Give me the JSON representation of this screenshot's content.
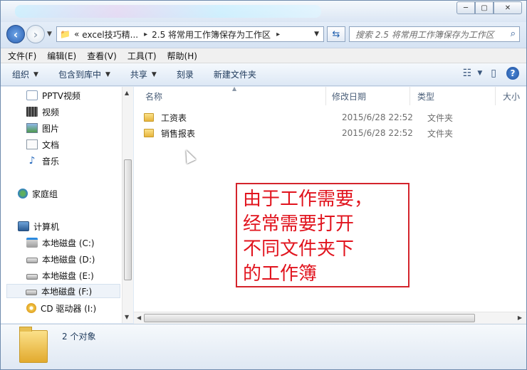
{
  "window": {
    "caption_buttons": {
      "minimize": "─",
      "maximize": "▢",
      "close": "✕"
    }
  },
  "address": {
    "crumb_prefix": "«",
    "crumbs": [
      "excel技巧精...",
      "2.5 将常用工作簿保存为工作区"
    ],
    "separator": "▸",
    "search_placeholder": "搜索 2.5 将常用工作簿保存为工作区"
  },
  "menu": [
    "文件(F)",
    "编辑(E)",
    "查看(V)",
    "工具(T)",
    "帮助(H)"
  ],
  "toolbar": {
    "organize": "组织",
    "include_library": "包含到库中",
    "share": "共享",
    "burn": "刻录",
    "new_folder": "新建文件夹",
    "help": "?"
  },
  "nav": {
    "favorites": [
      "PPTV视频",
      "视频",
      "图片",
      "文档",
      "音乐"
    ],
    "homegroup": "家庭组",
    "computer": "计算机",
    "drives": [
      "本地磁盘 (C:)",
      "本地磁盘 (D:)",
      "本地磁盘 (E:)",
      "本地磁盘 (F:)",
      "CD 驱动器 (I:)"
    ],
    "selected_drive": "本地磁盘 (F:)"
  },
  "columns": {
    "name": "名称",
    "date": "修改日期",
    "type": "类型",
    "size": "大小"
  },
  "files": [
    {
      "name": "工资表",
      "date": "2015/6/28 22:52",
      "type": "文件夹"
    },
    {
      "name": "销售报表",
      "date": "2015/6/28 22:52",
      "type": "文件夹"
    }
  ],
  "annotation": {
    "lines": [
      "由于工作需要，",
      "经常需要打开",
      "不同文件夹下",
      "的工作簿"
    ],
    "color": "#e1141e"
  },
  "status": {
    "text": "2 个对象"
  }
}
